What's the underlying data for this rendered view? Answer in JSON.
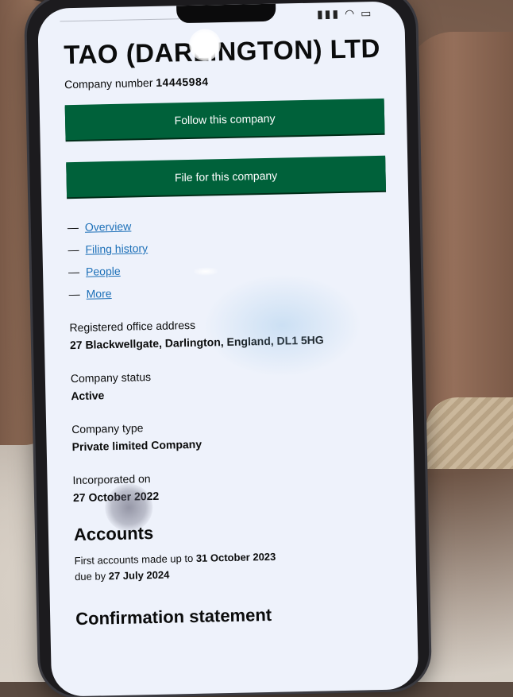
{
  "company": {
    "name": "TAO (DARLINGTON) LTD",
    "number_label": "Company number",
    "number": "14445984"
  },
  "actions": {
    "follow_label": "Follow this company",
    "file_label": "File for this company"
  },
  "nav": {
    "items": [
      {
        "label": "Overview"
      },
      {
        "label": "Filing history"
      },
      {
        "label": "People"
      },
      {
        "label": "More"
      }
    ]
  },
  "details": {
    "registered_office_label": "Registered office address",
    "registered_office_value": "27 Blackwellgate, Darlington, England, DL1 5HG",
    "status_label": "Company status",
    "status_value": "Active",
    "type_label": "Company type",
    "type_value": "Private limited Company",
    "incorporated_label": "Incorporated on",
    "incorporated_value": "27 October 2022"
  },
  "accounts": {
    "heading": "Accounts",
    "line1_prefix": "First accounts made up to",
    "line1_date": "31 October 2023",
    "line2_prefix": "due by",
    "line2_date": "27 July 2024"
  },
  "confirmation": {
    "heading": "Confirmation statement"
  },
  "colors": {
    "button_bg": "#00613a",
    "link": "#1d70b8",
    "text": "#0b0c0c"
  }
}
